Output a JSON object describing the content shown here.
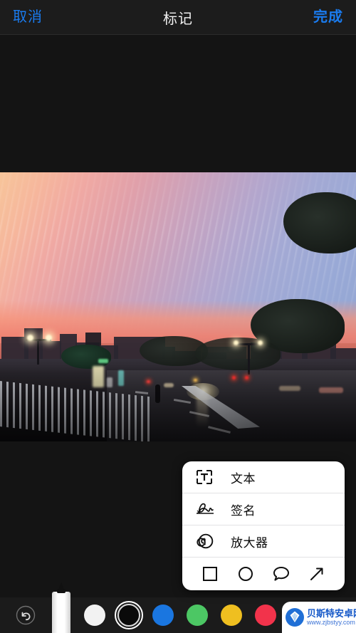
{
  "navbar": {
    "cancel_label": "取消",
    "title": "标记",
    "done_label": "完成",
    "accent_color": "#1a7cf0"
  },
  "popup": {
    "rows": [
      {
        "icon": "text-box-icon",
        "label": "文本"
      },
      {
        "icon": "signature-icon",
        "label": "签名"
      },
      {
        "icon": "magnifier-icon",
        "label": "放大器"
      }
    ],
    "shapes": [
      {
        "icon": "square-shape-icon",
        "label": "方形"
      },
      {
        "icon": "circle-shape-icon",
        "label": "圆形"
      },
      {
        "icon": "speech-bubble-shape-icon",
        "label": "对话气泡"
      },
      {
        "icon": "arrow-shape-icon",
        "label": "箭头"
      }
    ]
  },
  "toolbar": {
    "undo_icon": "undo-icon",
    "pen_tool": "marker-pen",
    "colors": [
      {
        "name": "白色",
        "hex": "#F2F2F2",
        "selected": false
      },
      {
        "name": "黑色",
        "hex": "#0A0A0A",
        "selected": true
      },
      {
        "name": "蓝色",
        "hex": "#1A76E0",
        "selected": false
      },
      {
        "name": "绿色",
        "hex": "#4CC764",
        "selected": false
      },
      {
        "name": "黄色",
        "hex": "#EFBF20",
        "selected": false
      },
      {
        "name": "红色",
        "hex": "#F2334B",
        "selected": false
      }
    ]
  },
  "photo": {
    "description": "城市街道黄昏照片"
  },
  "watermark": {
    "title": "贝斯特安卓网",
    "url": "www.zjbstyy.com",
    "color": "#1558c8"
  }
}
